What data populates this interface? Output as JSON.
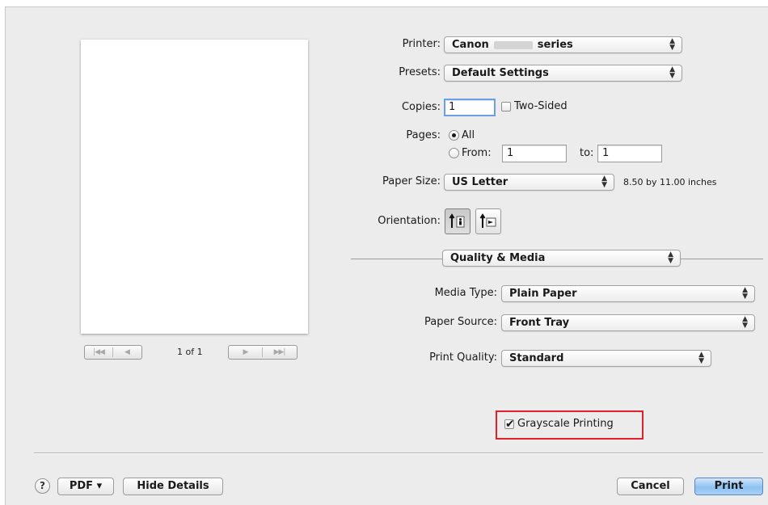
{
  "preview": {
    "page_indicator": "1 of 1",
    "first_page_glyph": "|◀◀",
    "prev_page_glyph": "◀",
    "next_page_glyph": "▶",
    "last_page_glyph": "▶▶|"
  },
  "printer": {
    "label": "Printer:",
    "value_prefix": "Canon",
    "value_suffix": "series"
  },
  "presets": {
    "label": "Presets:",
    "value": "Default Settings"
  },
  "copies": {
    "label": "Copies:",
    "value": "1",
    "two_sided_label": "Two-Sided",
    "two_sided_checked": false
  },
  "pages": {
    "label": "Pages:",
    "all_label": "All",
    "from_label": "From:",
    "from_value": "1",
    "to_label": "to:",
    "to_value": "1",
    "selected": "All"
  },
  "paper_size": {
    "label": "Paper Size:",
    "value": "US Letter",
    "dimensions": "8.50 by 11.00 inches"
  },
  "orientation": {
    "label": "Orientation:",
    "selected": "portrait"
  },
  "section_popup": {
    "value": "Quality & Media"
  },
  "media_type": {
    "label": "Media Type:",
    "value": "Plain Paper"
  },
  "paper_source": {
    "label": "Paper Source:",
    "value": "Front Tray"
  },
  "print_quality": {
    "label": "Print Quality:",
    "value": "Standard"
  },
  "grayscale": {
    "label": "Grayscale Printing",
    "checked": true,
    "check_glyph": "✔"
  },
  "footer": {
    "help_label": "?",
    "pdf_label": "PDF ▾",
    "hide_details_label": "Hide Details",
    "cancel_label": "Cancel",
    "print_label": "Print"
  },
  "colors": {
    "highlight": "#e0202a",
    "default_button": "#8ec1f2",
    "focus_ring": "#6a9ee6"
  },
  "icons": {
    "popup_arrows": "updown-arrows-icon",
    "portrait": "portrait-orientation-icon",
    "landscape": "landscape-orientation-icon"
  }
}
